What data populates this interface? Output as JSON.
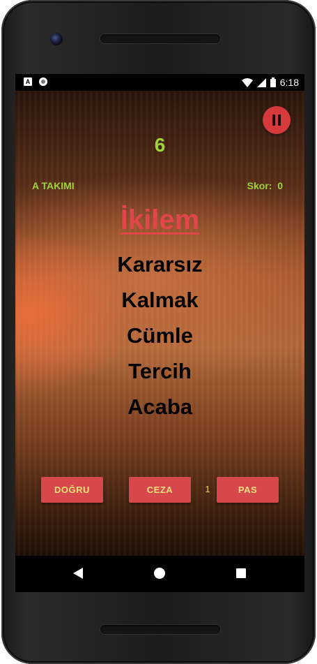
{
  "status_bar": {
    "notification_icons": [
      "a-icon",
      "circle-icon"
    ],
    "time": "6:18",
    "system_icons": [
      "wifi-icon",
      "signal-icon",
      "battery-icon"
    ]
  },
  "game": {
    "timer": "6",
    "team_name": "A TAKIMI",
    "score_label": "Skor:",
    "score_value": "0",
    "keyword": "İkilem",
    "taboo_words": [
      "Kararsız",
      "Kalmak",
      "Cümle",
      "Tercih",
      "Acaba"
    ]
  },
  "controls": {
    "correct_label": "DOĞRU",
    "penalty_label": "CEZA",
    "penalty_count": "1",
    "pass_label": "PAS"
  },
  "colors": {
    "accent_green": "#9ed43c",
    "button_red": "#d6484b",
    "button_text": "#f3e07c",
    "keyword_red": "#e0464a"
  }
}
